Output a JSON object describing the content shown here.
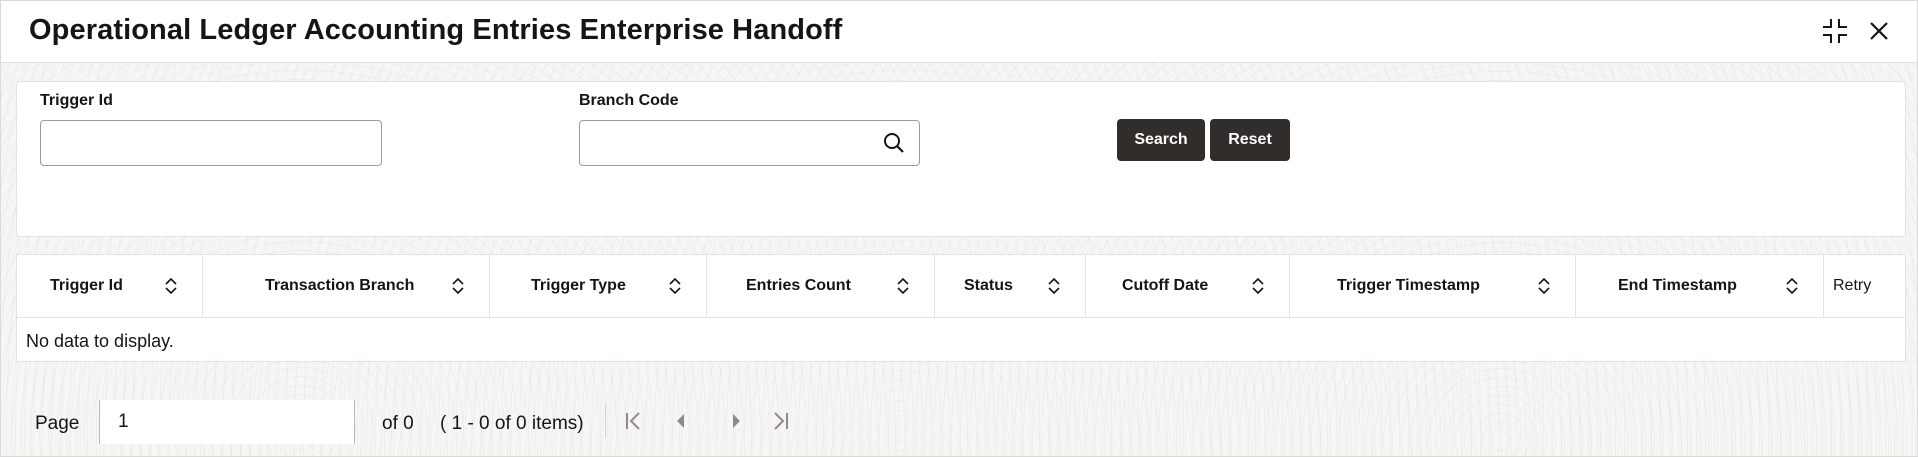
{
  "header": {
    "title": "Operational Ledger Accounting Entries Enterprise Handoff",
    "collapse_icon": "collapse-icon",
    "close_icon": "close-icon"
  },
  "search": {
    "trigger_id_label": "Trigger Id",
    "trigger_id_value": "",
    "branch_code_label": "Branch Code",
    "branch_code_value": "",
    "search_button": "Search",
    "reset_button": "Reset"
  },
  "table": {
    "columns": [
      "Trigger Id",
      "Transaction Branch",
      "Trigger Type",
      "Entries Count",
      "Status",
      "Cutoff Date",
      "Trigger Timestamp",
      "End Timestamp",
      "Retry"
    ],
    "empty_message": "No data to display."
  },
  "pager": {
    "page_label": "Page",
    "page_value": "1",
    "of_text": "of 0",
    "range_text": "( 1 - 0 of 0 items)"
  },
  "colors": {
    "button_bg": "#312d2a",
    "button_text": "#ffffff",
    "border": "#e4e2df"
  }
}
